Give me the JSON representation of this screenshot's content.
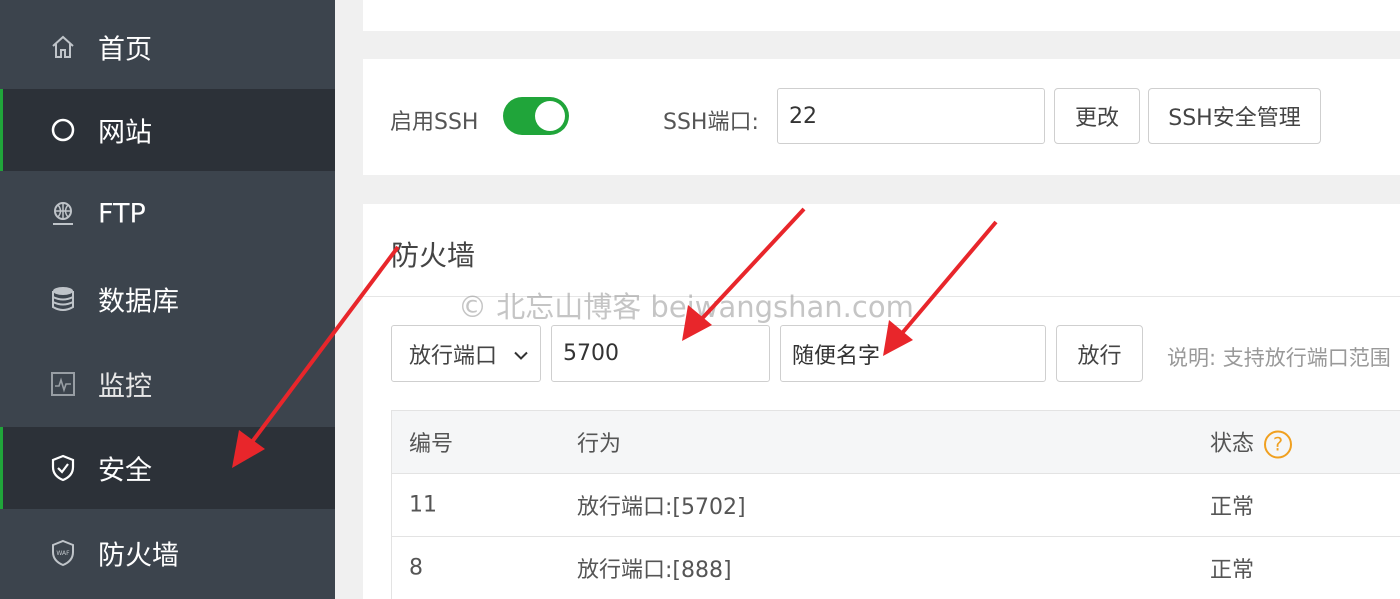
{
  "sidebar": {
    "items": [
      {
        "label": "首页",
        "icon": "home-icon",
        "active": false
      },
      {
        "label": "网站",
        "icon": "circle-icon",
        "active": true
      },
      {
        "label": "FTP",
        "icon": "ftp-globe-icon",
        "active": false
      },
      {
        "label": "数据库",
        "icon": "database-icon",
        "active": false
      },
      {
        "label": "监控",
        "icon": "monitor-icon",
        "active": false
      },
      {
        "label": "安全",
        "icon": "shield-icon",
        "active": true
      },
      {
        "label": "防火墙",
        "icon": "waf-shield-icon",
        "active": false
      }
    ]
  },
  "ssh": {
    "enable_label": "启用SSH",
    "enabled": true,
    "port_label": "SSH端口:",
    "port_value": "22",
    "change_button": "更改",
    "manage_button": "SSH安全管理"
  },
  "firewall": {
    "title": "防火墙",
    "select_value": "放行端口",
    "port_input": "5700",
    "name_input": "随便名字",
    "allow_button": "放行",
    "hint": "说明: 支持放行端口范围"
  },
  "table": {
    "headers": [
      "编号",
      "行为",
      "状态"
    ],
    "help_glyph": "?",
    "rows": [
      {
        "id": "11",
        "action": "放行端口:[5702]",
        "status": "正常"
      },
      {
        "id": "8",
        "action": "放行端口:[888]",
        "status": "正常"
      }
    ]
  },
  "watermark": "© 北忘山博客 beiwangshan.com",
  "colors": {
    "sidebar_bg": "#3c444d",
    "sidebar_active_bg": "#2c3138",
    "accent_green": "#20a53a",
    "annotation_red": "#e8262b",
    "help_orange": "#f0a020"
  }
}
